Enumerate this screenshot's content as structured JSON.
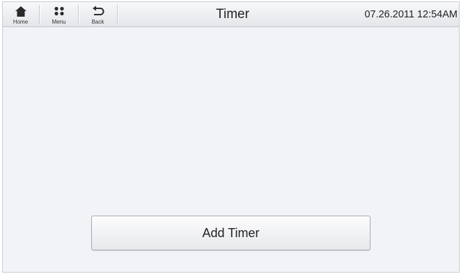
{
  "nav": {
    "home": {
      "label": "Home",
      "icon": "home-icon"
    },
    "menu": {
      "label": "Menu",
      "icon": "menu-grid-icon"
    },
    "back": {
      "label": "Back",
      "icon": "back-arrow-icon"
    }
  },
  "header": {
    "title": "Timer",
    "datetime": "07.26.2011 12:54AM"
  },
  "main": {
    "add_timer_label": "Add Timer"
  }
}
